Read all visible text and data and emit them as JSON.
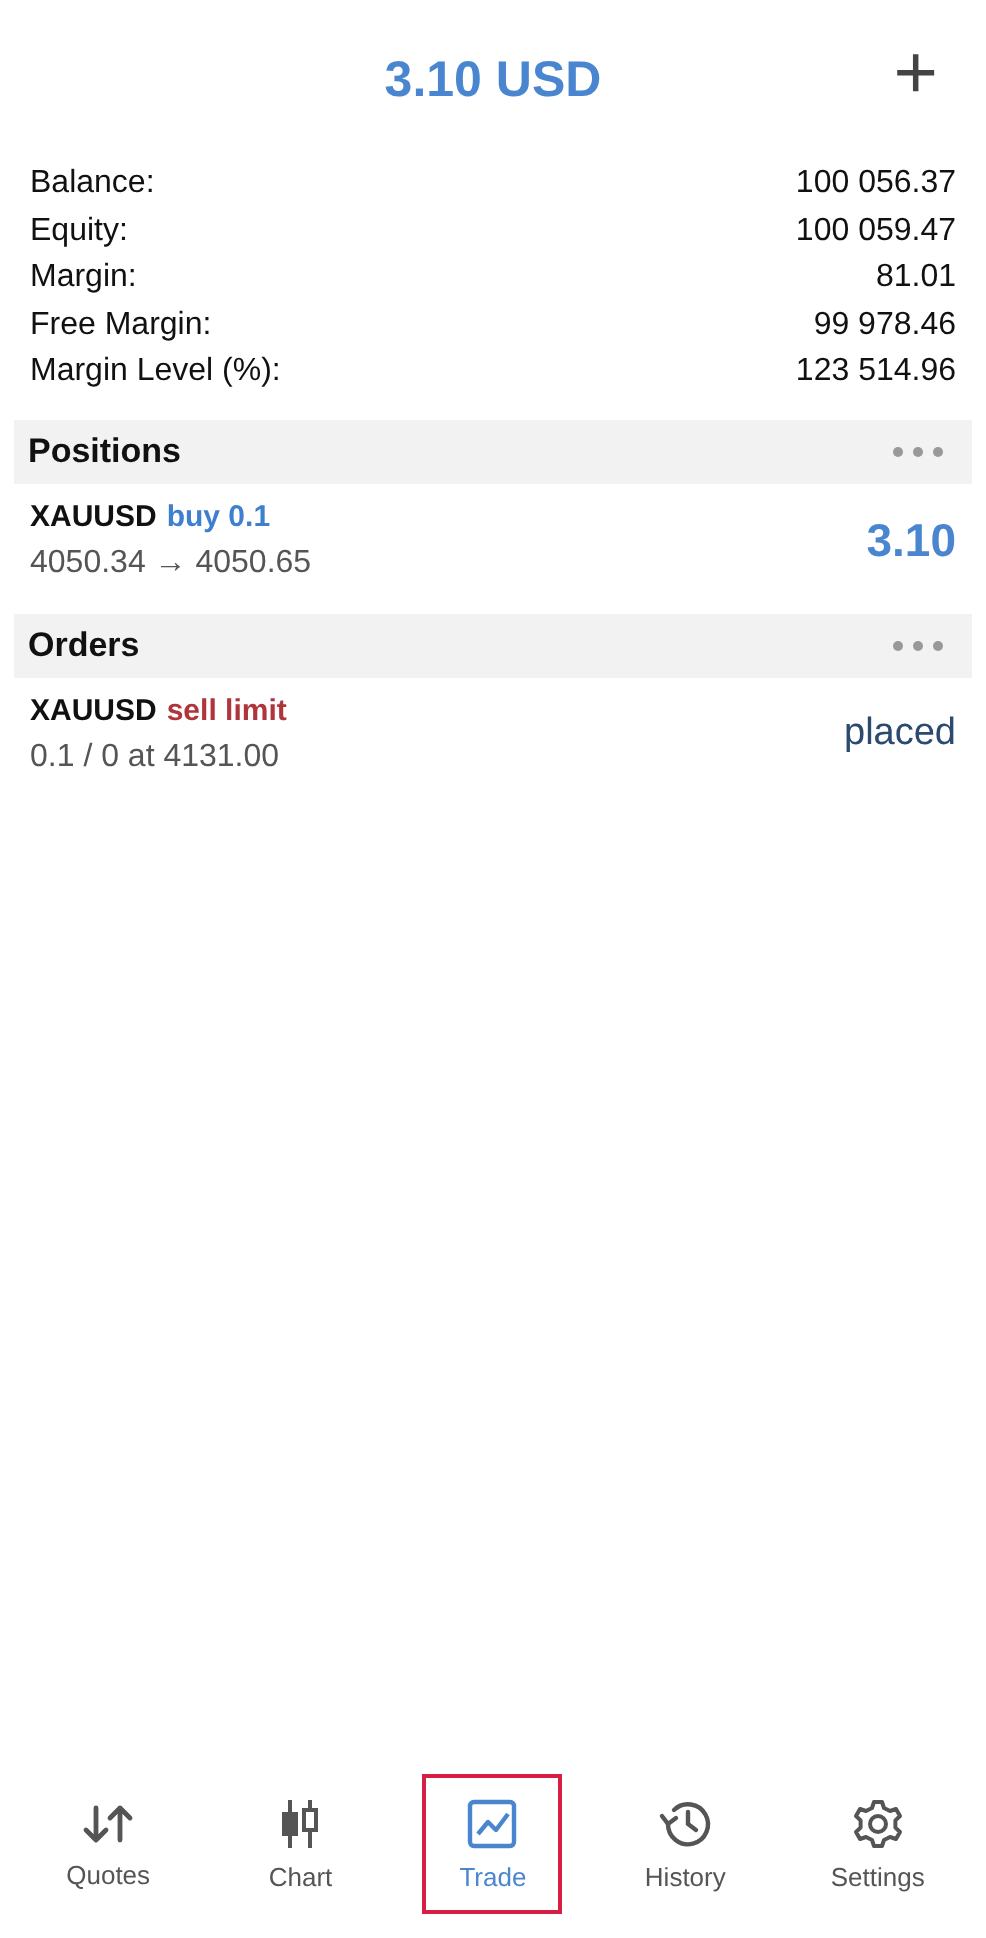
{
  "header": {
    "title": "3.10 USD",
    "add_icon": "+"
  },
  "summary": [
    {
      "label": "Balance:",
      "value": "100 056.37"
    },
    {
      "label": "Equity:",
      "value": "100 059.47"
    },
    {
      "label": "Margin:",
      "value": "81.01"
    },
    {
      "label": "Free Margin:",
      "value": "99 978.46"
    },
    {
      "label": "Margin Level (%):",
      "value": "123 514.96"
    }
  ],
  "positions": {
    "title": "Positions",
    "items": [
      {
        "symbol": "XAUUSD",
        "kind": "buy",
        "detail": "buy 0.1",
        "prices": "4050.34 → 4050.65",
        "result": "3.10"
      }
    ]
  },
  "orders": {
    "title": "Orders",
    "items": [
      {
        "symbol": "XAUUSD",
        "kind": "sell",
        "detail": "sell limit",
        "prices": "0.1 / 0 at 4131.00",
        "result": "placed"
      }
    ]
  },
  "tabs": [
    {
      "label": "Quotes",
      "selected": false
    },
    {
      "label": "Chart",
      "selected": false
    },
    {
      "label": "Trade",
      "selected": true
    },
    {
      "label": "History",
      "selected": false
    },
    {
      "label": "Settings",
      "selected": false
    }
  ]
}
